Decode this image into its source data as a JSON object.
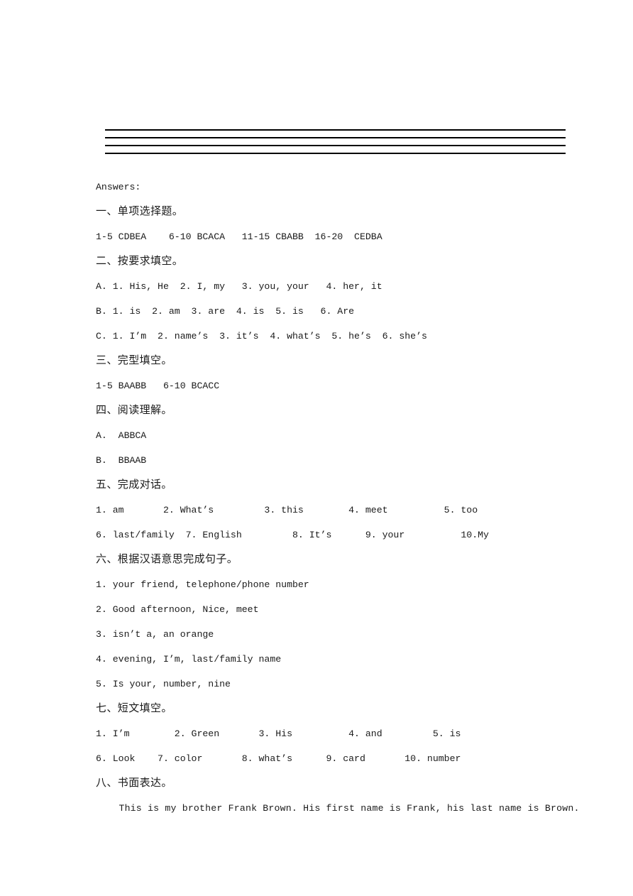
{
  "document": {
    "ruled_lines_count": 4,
    "heading": "Answers:",
    "sections": [
      {
        "id": "section-1",
        "title": "一、单项选择题。",
        "lines": [
          "1-5 CDBEA    6-10 BCACA   11-15 CBABB  16-20  CEDBA"
        ]
      },
      {
        "id": "section-2",
        "title": "二、按要求填空。",
        "lines": [
          "A. 1. His, He  2. I, my   3. you, your   4. her, it",
          "B. 1. is  2. am  3. are  4. is  5. is   6. Are",
          "C. 1. I’m  2. name’s  3. it’s  4. what’s  5. he’s  6. she’s"
        ]
      },
      {
        "id": "section-3",
        "title": "三、完型填空。",
        "lines": [
          "1-5 BAABB   6-10 BCACC"
        ]
      },
      {
        "id": "section-4",
        "title": "四、阅读理解。",
        "lines": [
          "A.  ABBCA",
          "B.  BBAAB"
        ]
      },
      {
        "id": "section-5",
        "title": "五、完成对话。",
        "lines": [
          "1. am       2. What’s         3. this        4. meet          5. too",
          "6. last/family  7. English         8. It’s      9. your          10.My"
        ]
      },
      {
        "id": "section-6",
        "title": "六、根据汉语意思完成句子。",
        "lines": [
          "1. your friend, telephone/phone number",
          "2. Good afternoon, Nice, meet",
          "3. isn’t a, an orange",
          "4. evening, I’m, last/family name",
          "5. Is your, number, nine"
        ]
      },
      {
        "id": "section-7",
        "title": "七、短文填空。",
        "lines": [
          "1. I’m        2. Green       3. His          4. and         5. is",
          "6. Look    7. color       8. what’s      9. card       10. number"
        ]
      },
      {
        "id": "section-8",
        "title": "八、书面表达。",
        "lines": [
          "    This is my brother Frank Brown. His first name is Frank, his last name is Brown."
        ]
      }
    ]
  }
}
